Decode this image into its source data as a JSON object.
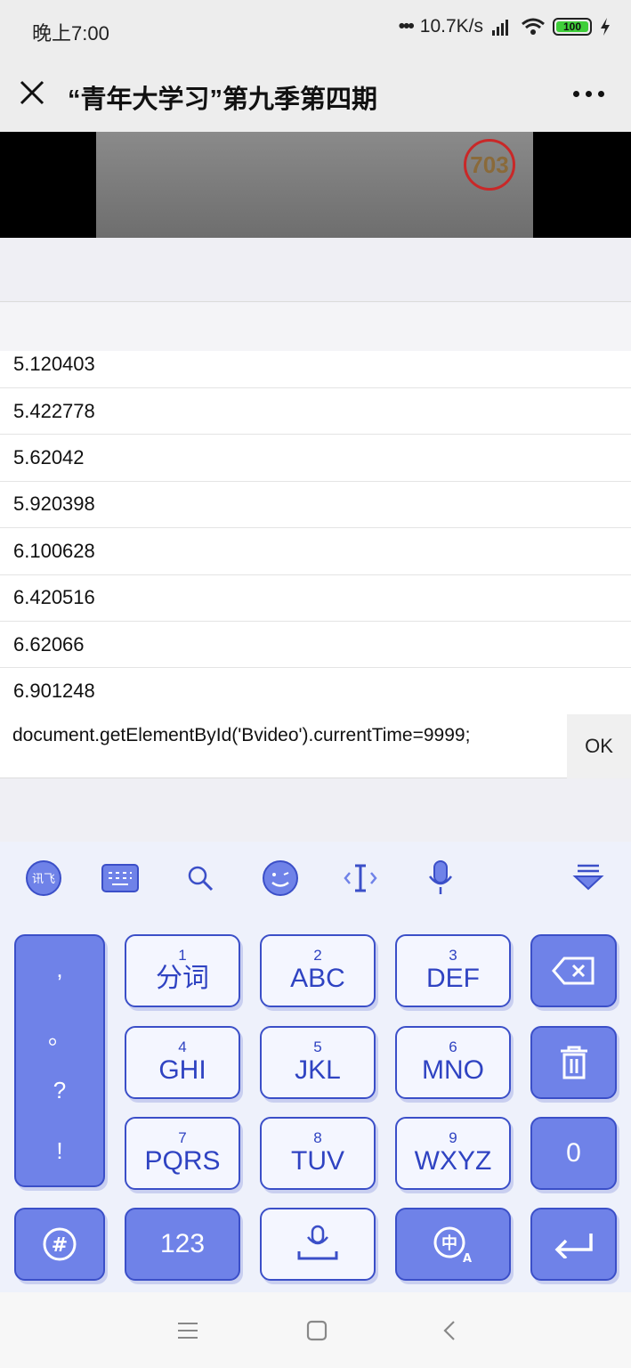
{
  "status_bar": {
    "time": "晚上7:00",
    "network_speed": "10.7K/s",
    "battery": "100"
  },
  "titlebar": {
    "title": "“青年大学习”第九季第四期"
  },
  "video": {
    "badge_number": "703"
  },
  "list": {
    "items": [
      "5.120403",
      "5.422778",
      "5.62042",
      "5.920398",
      "6.100628",
      "6.420516",
      "6.62066",
      "6.901248"
    ]
  },
  "input_bar": {
    "value": "document.getElementById('Bvideo').currentTime=9999;",
    "ok_label": "OK"
  },
  "keyboard": {
    "punctuation": [
      ",",
      "。",
      "?",
      "!"
    ],
    "row1": [
      {
        "num": "1",
        "label": "分词"
      },
      {
        "num": "2",
        "label": "ABC"
      },
      {
        "num": "3",
        "label": "DEF"
      }
    ],
    "row2": [
      {
        "num": "4",
        "label": "GHI"
      },
      {
        "num": "5",
        "label": "JKL"
      },
      {
        "num": "6",
        "label": "MNO"
      }
    ],
    "row3": [
      {
        "num": "7",
        "label": "PQRS"
      },
      {
        "num": "8",
        "label": "TUV"
      },
      {
        "num": "9",
        "label": "WXYZ"
      }
    ],
    "zero_label": "0",
    "numbers_label": "123",
    "symbol_label": "#",
    "lang_label": "中"
  },
  "colors": {
    "key_border": "#3b4fc8",
    "key_dark": "#6f82e8",
    "key_light": "#f4f6ff",
    "video_badge": "#c92828"
  }
}
